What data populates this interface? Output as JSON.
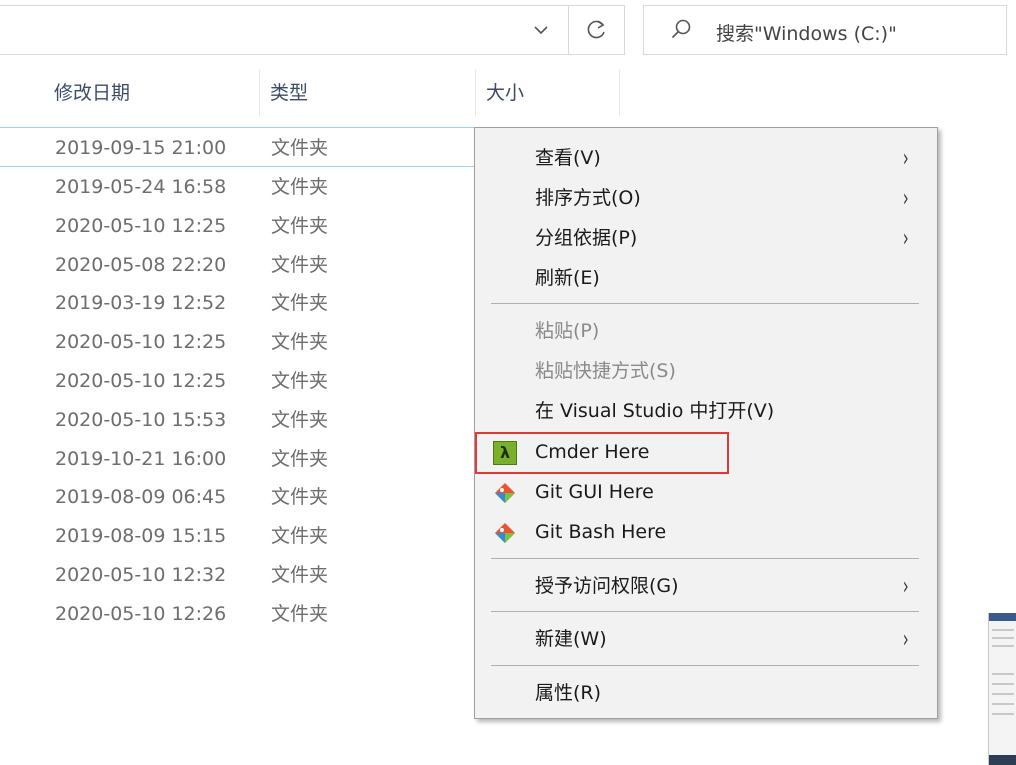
{
  "address_bar": {
    "dropdown_icon": "chevron-down-icon",
    "refresh_icon": "refresh-icon"
  },
  "search": {
    "placeholder": "搜索\"Windows (C:)\"",
    "icon": "search-icon"
  },
  "columns": [
    {
      "label": "修改日期"
    },
    {
      "label": "类型"
    },
    {
      "label": "大小"
    }
  ],
  "rows": [
    {
      "date": "2019-09-15 21:00",
      "type": "文件夹"
    },
    {
      "date": "2019-05-24 16:58",
      "type": "文件夹"
    },
    {
      "date": "2020-05-10 12:25",
      "type": "文件夹"
    },
    {
      "date": "2020-05-08 22:20",
      "type": "文件夹"
    },
    {
      "date": "2019-03-19 12:52",
      "type": "文件夹"
    },
    {
      "date": "2020-05-10 12:25",
      "type": "文件夹"
    },
    {
      "date": "2020-05-10 12:25",
      "type": "文件夹"
    },
    {
      "date": "2020-05-10 15:53",
      "type": "文件夹"
    },
    {
      "date": "2019-10-21 16:00",
      "type": "文件夹"
    },
    {
      "date": "2019-08-09 06:45",
      "type": "文件夹"
    },
    {
      "date": "2019-08-09 15:15",
      "type": "文件夹"
    },
    {
      "date": "2020-05-10 12:32",
      "type": "文件夹"
    },
    {
      "date": "2020-05-10 12:26",
      "type": "文件夹"
    }
  ],
  "context_menu": {
    "view": "查看(V)",
    "sort_by": "排序方式(O)",
    "group_by": "分组依据(P)",
    "refresh": "刷新(E)",
    "paste": "粘贴(P)",
    "paste_shortcut": "粘贴快捷方式(S)",
    "open_in_vs": "在 Visual Studio 中打开(V)",
    "cmder_here": "Cmder Here",
    "cmder_icon_glyph": "λ",
    "git_gui_here": "Git GUI Here",
    "git_bash_here": "Git Bash Here",
    "give_access": "授予访问权限(G)",
    "new": "新建(W)",
    "properties": "属性(R)",
    "arrow": "›"
  },
  "colors": {
    "highlight_border": "#e0393a",
    "selection_border": "#99d1ff",
    "git_orange": "#f05133",
    "git_blue": "#2f8fd6",
    "git_green": "#7cc242",
    "cmder_green": "#7ab02c"
  }
}
